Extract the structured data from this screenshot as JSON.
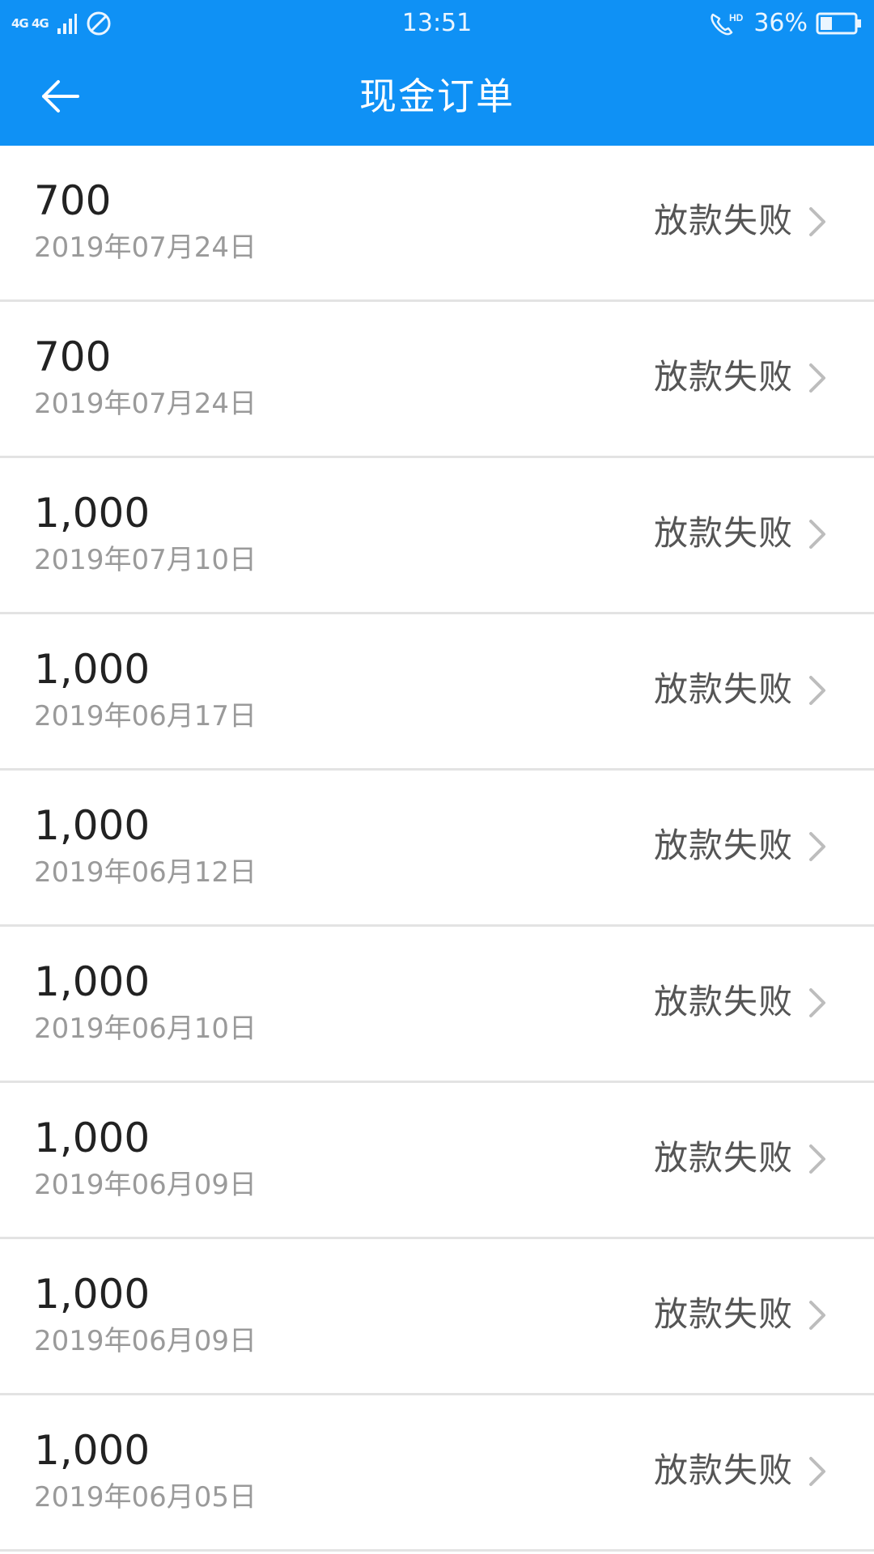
{
  "status_bar": {
    "network_label": "4G 4G",
    "time": "13:51",
    "battery_percent": "36%",
    "battery_level": 0.36,
    "icons": [
      "signal-icon",
      "do-not-disturb-icon",
      "hd-call-icon",
      "battery-icon"
    ]
  },
  "header": {
    "title": "现金订单",
    "back_icon": "arrow-left-icon"
  },
  "colors": {
    "accent": "#0f91f5",
    "amount_text": "#222222",
    "date_text": "#9a9a9a",
    "status_text": "#555555",
    "divider": "#e3e3e3"
  },
  "orders": [
    {
      "amount": "700",
      "date": "2019年07月24日",
      "status": "放款失败"
    },
    {
      "amount": "700",
      "date": "2019年07月24日",
      "status": "放款失败"
    },
    {
      "amount": "1,000",
      "date": "2019年07月10日",
      "status": "放款失败"
    },
    {
      "amount": "1,000",
      "date": "2019年06月17日",
      "status": "放款失败"
    },
    {
      "amount": "1,000",
      "date": "2019年06月12日",
      "status": "放款失败"
    },
    {
      "amount": "1,000",
      "date": "2019年06月10日",
      "status": "放款失败"
    },
    {
      "amount": "1,000",
      "date": "2019年06月09日",
      "status": "放款失败"
    },
    {
      "amount": "1,000",
      "date": "2019年06月09日",
      "status": "放款失败"
    },
    {
      "amount": "1,000",
      "date": "2019年06月05日",
      "status": "放款失败"
    }
  ]
}
